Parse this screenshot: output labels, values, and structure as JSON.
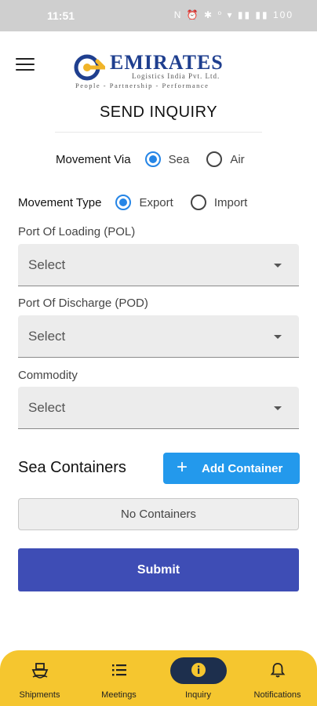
{
  "status_bar": {
    "time": "11:51",
    "icons": "N ⏰ ✱ ⁰ ▾ ▮▮ ▮▮ 100"
  },
  "app": {
    "logo": {
      "word": "EMIRATES",
      "sub": "Logistics India Pvt. Ltd.",
      "tagline": "People - Partnership - Performance"
    },
    "menu_icon": "hamburger-icon"
  },
  "page": {
    "title": "SEND INQUIRY"
  },
  "movement_via": {
    "label": "Movement Via",
    "options": [
      "Sea",
      "Air"
    ],
    "selected": "Sea"
  },
  "movement_type": {
    "label": "Movement Type",
    "options": [
      "Export",
      "Import"
    ],
    "selected": "Export"
  },
  "fields": [
    {
      "label": "Port Of Loading (POL)",
      "value": "Select"
    },
    {
      "label": "Port Of Discharge (POD)",
      "value": "Select"
    },
    {
      "label": "Commodity",
      "value": "Select"
    }
  ],
  "containers": {
    "title": "Sea Containers",
    "add_label": "Add Container",
    "empty_text": "No Containers"
  },
  "submit_label": "Submit",
  "bottom_nav": [
    {
      "label": "Shipments",
      "icon": "ship-icon",
      "active": false
    },
    {
      "label": "Meetings",
      "icon": "list-icon",
      "active": false
    },
    {
      "label": "Inquiry",
      "icon": "info-icon",
      "active": true
    },
    {
      "label": "Notifications",
      "icon": "bell-icon",
      "active": false
    }
  ],
  "colors": {
    "accent": "#2585e6",
    "add_button": "#2399ec",
    "submit": "#3e4db5",
    "nav_bg": "#f5c62f",
    "nav_active": "#1d2f4d",
    "brand": "#1f3f8f"
  }
}
